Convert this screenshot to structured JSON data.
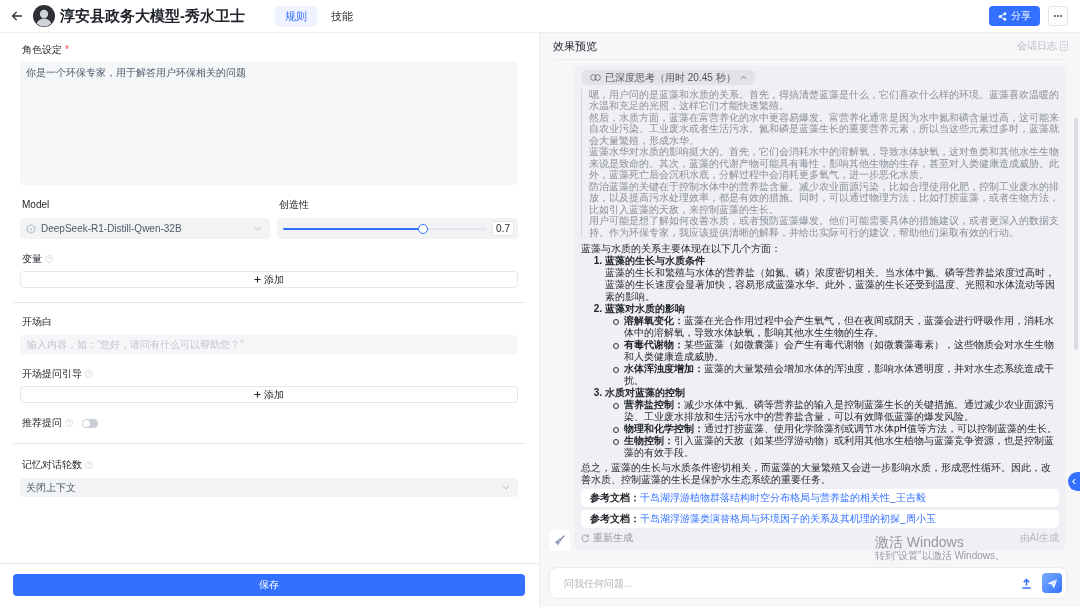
{
  "header": {
    "title": "淳安县政务大模型-秀水卫士",
    "tabs": [
      {
        "label": "规则",
        "selected": true
      },
      {
        "label": "技能",
        "selected": false
      }
    ],
    "share_button": "分享"
  },
  "config": {
    "role": {
      "label": "角色设定",
      "required_mark": "*",
      "value": "你是一个环保专家，用于解答用户环保相关的问题"
    },
    "model": {
      "label": "Model",
      "value": "DeepSeek-R1-Distill-Qwen-32B"
    },
    "creativity": {
      "label": "创造性",
      "level": 0.7,
      "reading": "0.7"
    },
    "variables": {
      "label": "变量",
      "add_button": "添加"
    },
    "opening": {
      "label": "开场白",
      "placeholder": "输入内容，如：“您好，请问有什么可以帮助您？”"
    },
    "opening_questions": {
      "label": "开场提问引导",
      "add_button": "添加"
    },
    "suggested_questions": {
      "label": "推荐提问",
      "on": false
    },
    "memory": {
      "label": "记忆对话轮数",
      "value": "关闭上下文"
    },
    "save_button": "保存"
  },
  "preview": {
    "title": "效果预览",
    "log_link": "会话日志",
    "message": {
      "thinking_label": "已深度思考（用时 20.45 秒）",
      "thinking": [
        "嗯，用户问的是蓝藻和水质的关系。首先，得搞清楚蓝藻是什么，它们喜欢什么样的环境。蓝藻喜欢温暖的水温和充足的光照，这样它们才能快速繁殖。",
        "然后，水质方面，蓝藻在富营养化的水中更容易爆发。富营养化通常是因为水中氮和磷含量过高，这可能来自农业污染、工业废水或者生活污水。氮和磷是蓝藻生长的重要营养元素，所以当这些元素过多时，蓝藻就会大量繁殖，形成水华。",
        "蓝藻水华对水质的影响挺大的。首先，它们会消耗水中的溶解氧，导致水体缺氧，这对鱼类和其他水生生物来说是致命的。其次，蓝藻的代谢产物可能具有毒性，影响其他生物的生存，甚至对人类健康造成威胁。此外，蓝藻死亡后会沉积水底，分解过程中会消耗更多氧气，进一步恶化水质。",
        "防治蓝藻的关键在于控制水体中的营养盐含量。减少农业面源污染，比如合理使用化肥，控制工业废水的排放，以及提高污水处理效率，都是有效的措施。同时，可以通过物理方法，比如打捞蓝藻，或者生物方法，比如引入蓝藻的天敌，来控制蓝藻的生长。",
        "用户可能是想了解如何改善水质，或者预防蓝藻爆发。他们可能需要具体的措施建议，或者更深入的数据支持。作为环保专家，我应该提供清晰的解释，并给出实际可行的建议，帮助他们采取有效的行动。"
      ],
      "answer": {
        "intro": "蓝藻与水质的关系主要体现在以下几个方面：",
        "sections": [
          {
            "kind": "paragraph",
            "number": "1.",
            "heading": "蓝藻的生长与水质条件",
            "paragraph": "蓝藻的生长和繁殖与水体的营养盐（如氮、磷）浓度密切相关。当水体中氮、磷等营养盐浓度过高时，蓝藻的生长速度会显著加快，容易形成蓝藻水华。此外，蓝藻的生长还受到温度、光照和水体流动等因素的影响。"
          },
          {
            "kind": "bullets",
            "number": "2.",
            "heading": "蓝藻对水质的影响",
            "bullets": [
              "**溶解氧变化：**蓝藻在光合作用过程中会产生氧气，但在夜间或阴天，蓝藻会进行呼吸作用，消耗水体中的溶解氧，导致水体缺氧，影响其他水生生物的生存。",
              "**有毒代谢物：**某些蓝藻（如微囊藻）会产生有毒代谢物（如微囊藻毒素），这些物质会对水生生物和人类健康造成威胁。",
              "**水体浑浊度增加：**蓝藻的大量繁殖会增加水体的浑浊度，影响水体透明度，并对水生态系统造成干扰。"
            ]
          },
          {
            "kind": "bullets",
            "number": "3.",
            "heading": "水质对蓝藻的控制",
            "bullets": [
              "**营养盐控制：**减少水体中氮、磷等营养盐的输入是控制蓝藻生长的关键措施。通过减少农业面源污染、工业废水排放和生活污水中的营养盐含量，可以有效降低蓝藻的爆发风险。",
              "**物理和化学控制：**通过打捞蓝藻、使用化学除藻剂或调节水体pH值等方法，可以控制蓝藻的生长。",
              "**生物控制：**引入蓝藻的天敌（如某些浮游动物）或利用其他水生植物与蓝藻竞争资源，也是控制蓝藻的有效手段。"
            ]
          }
        ],
        "conclusion": "总之，蓝藻的生长与水质条件密切相关，而蓝藻的大量繁殖又会进一步影响水质，形成恶性循环。因此，改善水质、控制蓝藻的生长是保护水生态系统的重要任务。"
      },
      "references": [
        {
          "label": "参考文档：",
          "title": "千岛湖浮游植物群落结构时空分布格局与营养盐的相关性_王吉毅"
        },
        {
          "label": "参考文档：",
          "title": "千岛湖浮游藻类演替格局与环境因子的关系及其机理的初探_周小玉"
        }
      ],
      "regenerate": "重新生成",
      "ai_note": "由AI生成"
    },
    "input": {
      "placeholder": "问我任何问题..."
    }
  },
  "os_notice": {
    "title": "激活 Windows",
    "subtitle": "转到“设置”以激活 Windows。"
  }
}
